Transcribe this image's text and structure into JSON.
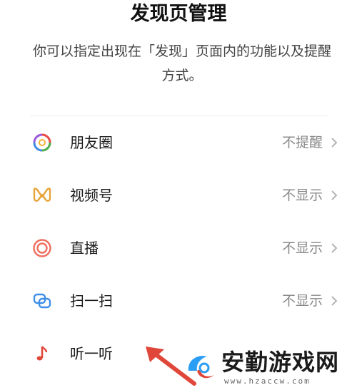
{
  "header": {
    "title": "发现页管理",
    "description": "你可以指定出现在「发现」页面内的功能以及提醒方式。"
  },
  "items": [
    {
      "label": "朋友圈",
      "value": "不提醒",
      "icon": "moments-icon"
    },
    {
      "label": "视频号",
      "value": "不显示",
      "icon": "channels-icon"
    },
    {
      "label": "直播",
      "value": "不显示",
      "icon": "live-icon"
    },
    {
      "label": "扫一扫",
      "value": "不显示",
      "icon": "scan-icon"
    },
    {
      "label": "听一听",
      "value": "",
      "icon": "music-note-icon"
    }
  ],
  "watermark": {
    "text": "安勤游戏网",
    "url": "www.hzaccw.com"
  },
  "colors": {
    "accent_red": "#e0463a",
    "value_gray": "#8a8a8a"
  }
}
